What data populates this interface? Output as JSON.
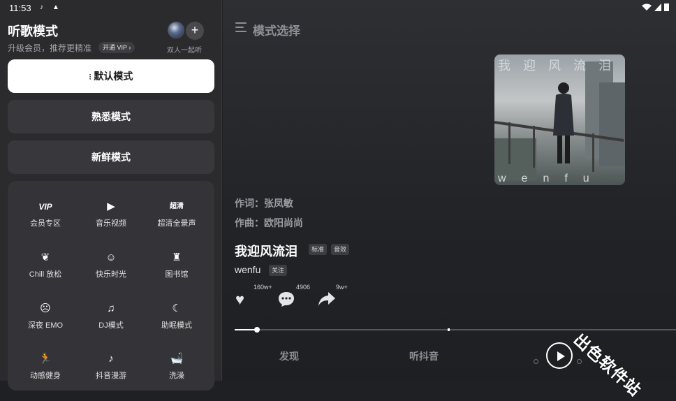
{
  "status_bar": {
    "time": "11:53"
  },
  "sidebar": {
    "title": "听歌模式",
    "subtitle": "升级会员，推荐更精准",
    "vip_chip": "开通 VIP",
    "duo_label": "双人一起听",
    "modes": [
      {
        "label": "默认模式",
        "active": true
      },
      {
        "label": "熟悉模式",
        "active": false
      },
      {
        "label": "新鲜模式",
        "active": false
      }
    ],
    "grid": [
      {
        "icon": "vip-icon",
        "glyph": "VIP",
        "label": "会员专区"
      },
      {
        "icon": "video-play-icon",
        "glyph": "▶",
        "label": "音乐视频"
      },
      {
        "icon": "hd-audio-icon",
        "glyph": "超清",
        "label": "超清全景声"
      },
      {
        "icon": "leaf-icon",
        "glyph": "❦",
        "label": "Chill 放松"
      },
      {
        "icon": "smile-icon",
        "glyph": "☺",
        "label": "快乐时光"
      },
      {
        "icon": "library-icon",
        "glyph": "♜",
        "label": "图书馆"
      },
      {
        "icon": "sad-face-icon",
        "glyph": "☹",
        "label": "深夜 EMO"
      },
      {
        "icon": "dj-icon",
        "glyph": "♫",
        "label": "DJ模式"
      },
      {
        "icon": "moon-icon",
        "glyph": "☾",
        "label": "助眠模式"
      },
      {
        "icon": "running-icon",
        "glyph": "🏃",
        "label": "动感健身"
      },
      {
        "icon": "tiktok-icon",
        "glyph": "♪",
        "label": "抖音漫游"
      },
      {
        "icon": "bathtub-icon",
        "glyph": "🛁",
        "label": "洗澡"
      }
    ]
  },
  "main": {
    "title": "模式选择",
    "cover_top_text": "我迎风流泪",
    "cover_bottom_text": "wenfu",
    "lyricist": "作词：张凤敏",
    "composer": "作曲：欧阳尚尚",
    "song_title": "我迎风流泪",
    "tags": [
      "标准",
      "音效"
    ],
    "artist": "wenfu",
    "follow_label": "关注",
    "actions": [
      {
        "icon": "heart-icon",
        "count": "160w+"
      },
      {
        "icon": "comment-icon",
        "count": "4906"
      },
      {
        "icon": "share-icon",
        "count": "9w+"
      }
    ],
    "progress": 0.05,
    "bottom_nav": {
      "discover": "发现",
      "douyin": "听抖音"
    }
  },
  "watermark": "出色软件站",
  "colors": {
    "panel_bg": "#2b2b2e",
    "active_mode_bg": "#ffffff",
    "accent_text": "#ffffff"
  }
}
